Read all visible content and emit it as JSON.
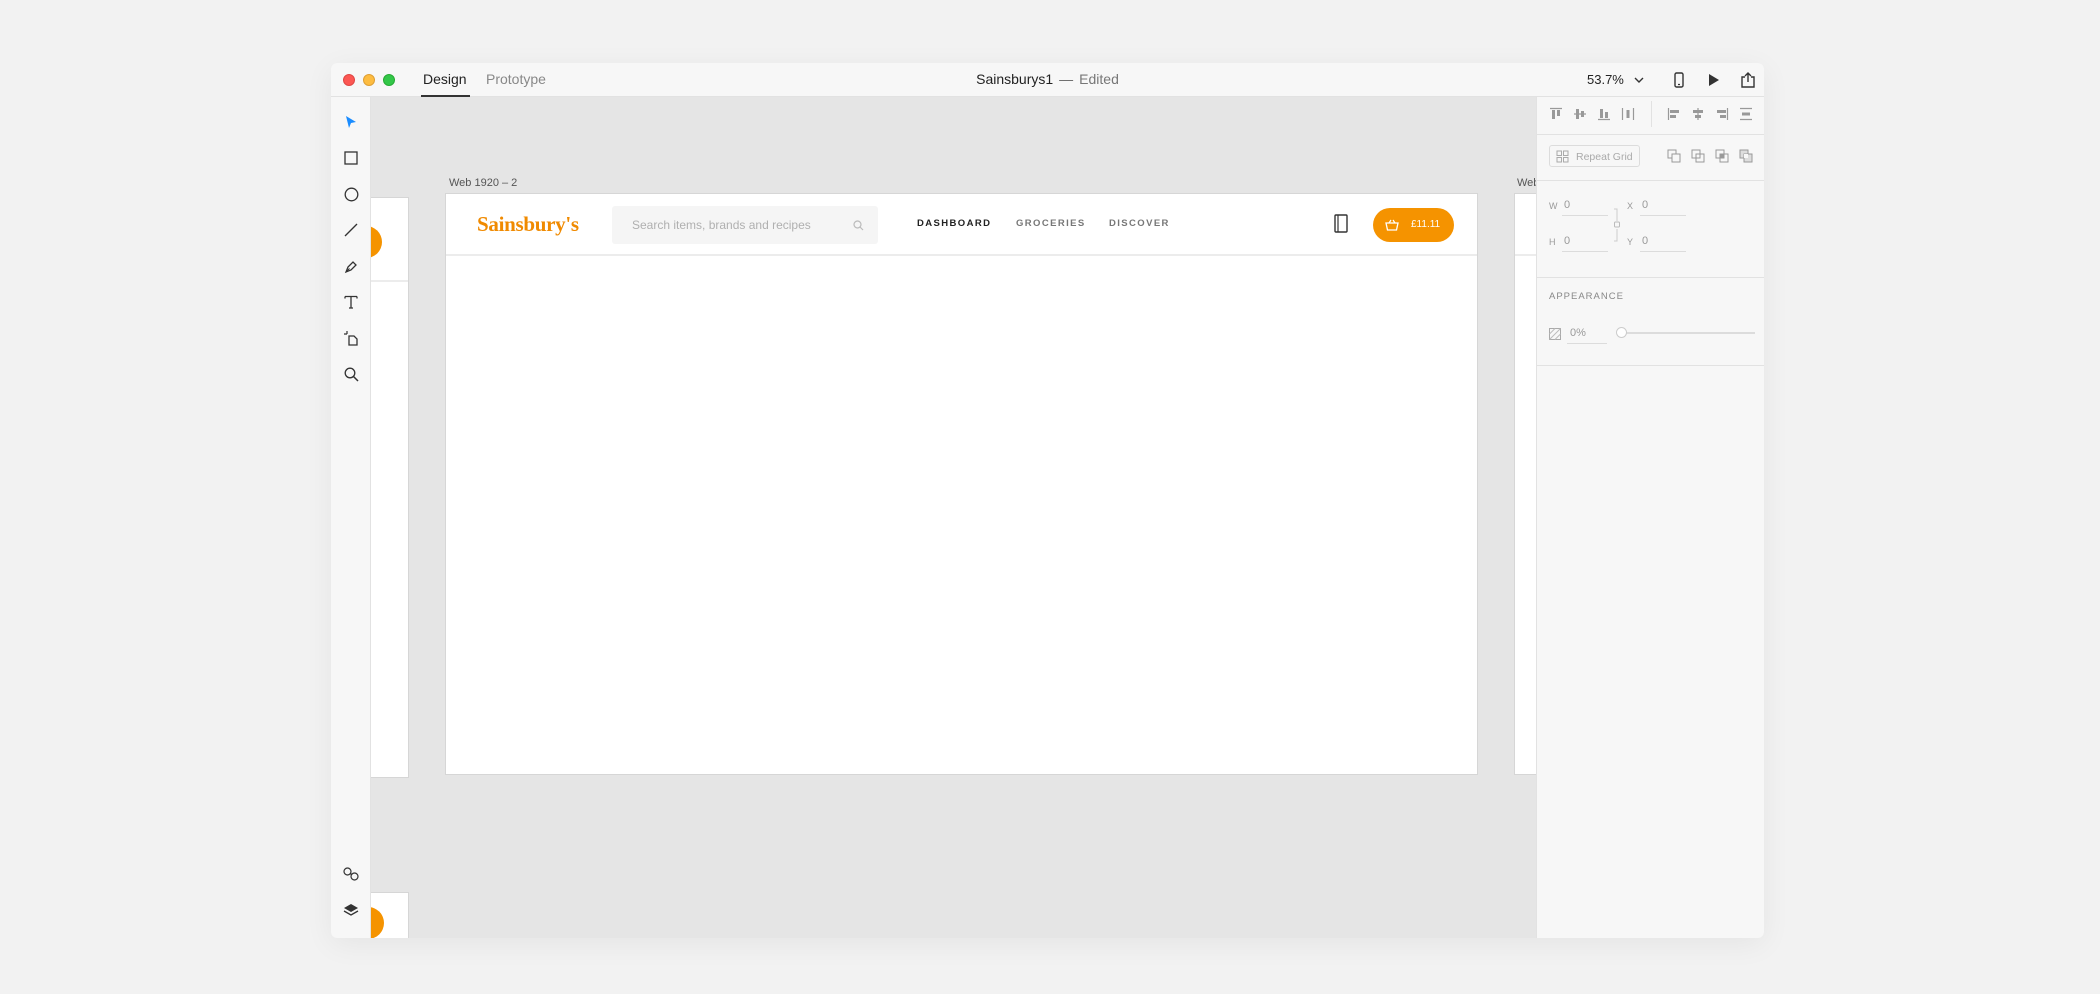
{
  "titlebar": {
    "tabs": [
      {
        "label": "Design",
        "active": true
      },
      {
        "label": "Prototype",
        "active": false
      }
    ],
    "doc_title": "Sainsburys1",
    "separator": "—",
    "doc_status": "Edited",
    "zoom": "53.7%",
    "icons": [
      "chevron-down-icon",
      "mobile-preview-icon",
      "play-icon",
      "share-icon"
    ]
  },
  "tools": [
    "select-icon",
    "rectangle-icon",
    "ellipse-icon",
    "line-icon",
    "pen-icon",
    "text-icon",
    "artboard-icon",
    "zoom-icon",
    "symbols-icon",
    "layers-icon"
  ],
  "artboards": {
    "main_label": "Web 1920 – 2",
    "right_label": "Web"
  },
  "site": {
    "logo": "Sainsbury's",
    "search_placeholder": "Search items, brands and recipes",
    "nav": [
      {
        "label": "DASHBOARD",
        "active": true
      },
      {
        "label": "GROCERIES",
        "active": false
      },
      {
        "label": "DISCOVER",
        "active": false
      }
    ],
    "basket_total": "£11.11"
  },
  "panel": {
    "repeat_grid": "Repeat Grid",
    "w_label": "W",
    "w_value": "0",
    "x_label": "X",
    "x_value": "0",
    "h_label": "H",
    "h_value": "0",
    "y_label": "Y",
    "y_value": "0",
    "appearance_title": "APPEARANCE",
    "opacity": "0%"
  },
  "colors": {
    "brand_orange": "#f59300",
    "logo_orange": "#f08a00",
    "select_blue": "#1a8cff"
  }
}
